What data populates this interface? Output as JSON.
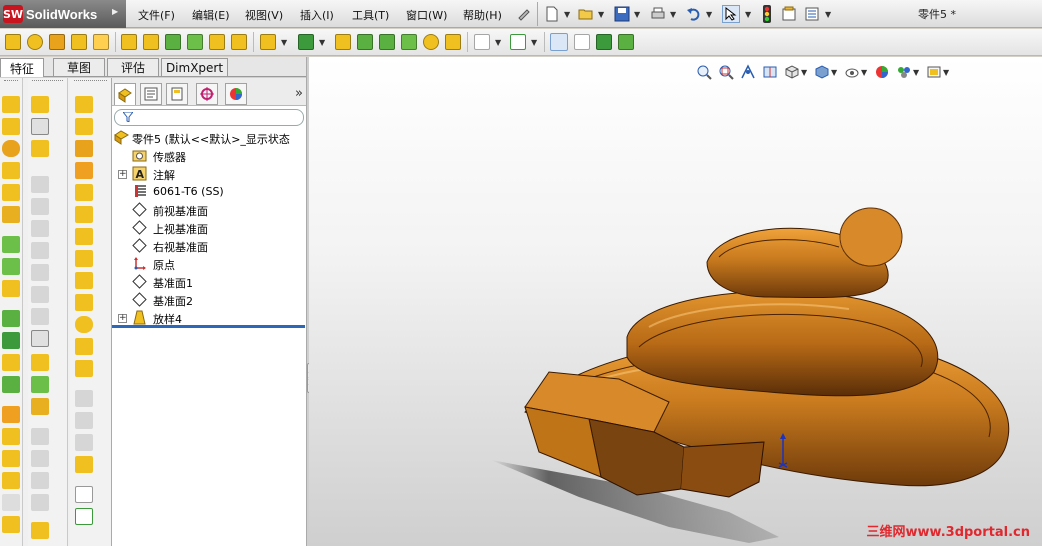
{
  "app": {
    "brand": "SolidWorks",
    "logo_mark": "SW",
    "document_title": "零件5 *"
  },
  "menu": [
    {
      "label": "文件(F)"
    },
    {
      "label": "编辑(E)"
    },
    {
      "label": "视图(V)"
    },
    {
      "label": "插入(I)"
    },
    {
      "label": "工具(T)"
    },
    {
      "label": "窗口(W)"
    },
    {
      "label": "帮助(H)"
    }
  ],
  "command_manager": {
    "tabs": [
      "特征",
      "草图",
      "评估",
      "DimXpert"
    ],
    "active_tab": "特征"
  },
  "feature_tree": {
    "root": {
      "label": "零件5   (默认<<默认>_显示状态",
      "icon": "part-icon"
    },
    "items": [
      {
        "label": "传感器",
        "icon": "sensor-folder-icon",
        "expandable": false
      },
      {
        "label": "注解",
        "icon": "annotations-icon",
        "expandable": true
      },
      {
        "label": "6061-T6 (SS)",
        "icon": "material-icon",
        "expandable": false
      },
      {
        "label": "前视基准面",
        "icon": "plane-icon",
        "expandable": false
      },
      {
        "label": "上视基准面",
        "icon": "plane-icon",
        "expandable": false
      },
      {
        "label": "右视基准面",
        "icon": "plane-icon",
        "expandable": false
      },
      {
        "label": "原点",
        "icon": "origin-icon",
        "expandable": false
      },
      {
        "label": "基准面1",
        "icon": "plane-icon",
        "expandable": false
      },
      {
        "label": "基准面2",
        "icon": "plane-icon",
        "expandable": false
      },
      {
        "label": "放样4",
        "icon": "loft-feature-icon",
        "expandable": true
      }
    ]
  },
  "viewport": {
    "watermark": "三维网www.3dportal.cn",
    "model_color": "#c87a1e",
    "background_top": "#ffffff",
    "background_bottom": "#cfcfcf"
  },
  "colors": {
    "accent_blue": "#2d67b8",
    "feature_yellow": "#f0c020",
    "brand_red": "#c8141e"
  }
}
